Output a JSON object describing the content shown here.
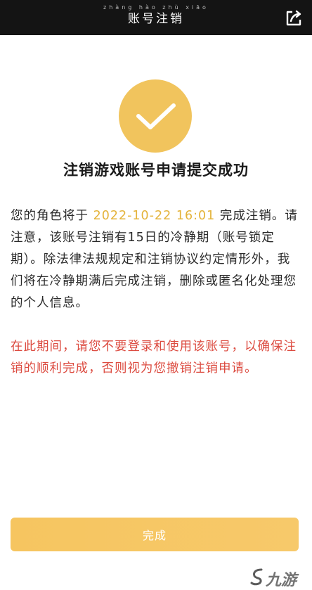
{
  "header": {
    "title_ruby": "zhàng hào zhù xiāo",
    "title": "账号注销"
  },
  "status": {
    "headline": "注销游戏账号申请提交成功"
  },
  "notice": {
    "prefix": "您的角色将于 ",
    "datetime": "2022-10-22 16:01",
    "suffix": " 完成注销。请注意，该账号注销有15日的冷静期（账号锁定期）。除法律法规规定和注销协议约定情形外，我们将在冷静期满后完成注销，删除或匿名化处理您的个人信息。",
    "warning": "在此期间，请您不要登录和使用该账号，以确保注销的顺利完成，否则视为您撤销注销申请。"
  },
  "actions": {
    "done_label": "完成"
  },
  "watermark": {
    "text": "九游"
  },
  "colors": {
    "accent": "#f1c45d",
    "highlight": "#e4b33a",
    "warning": "#dc4b40",
    "topbar": "#141414"
  }
}
